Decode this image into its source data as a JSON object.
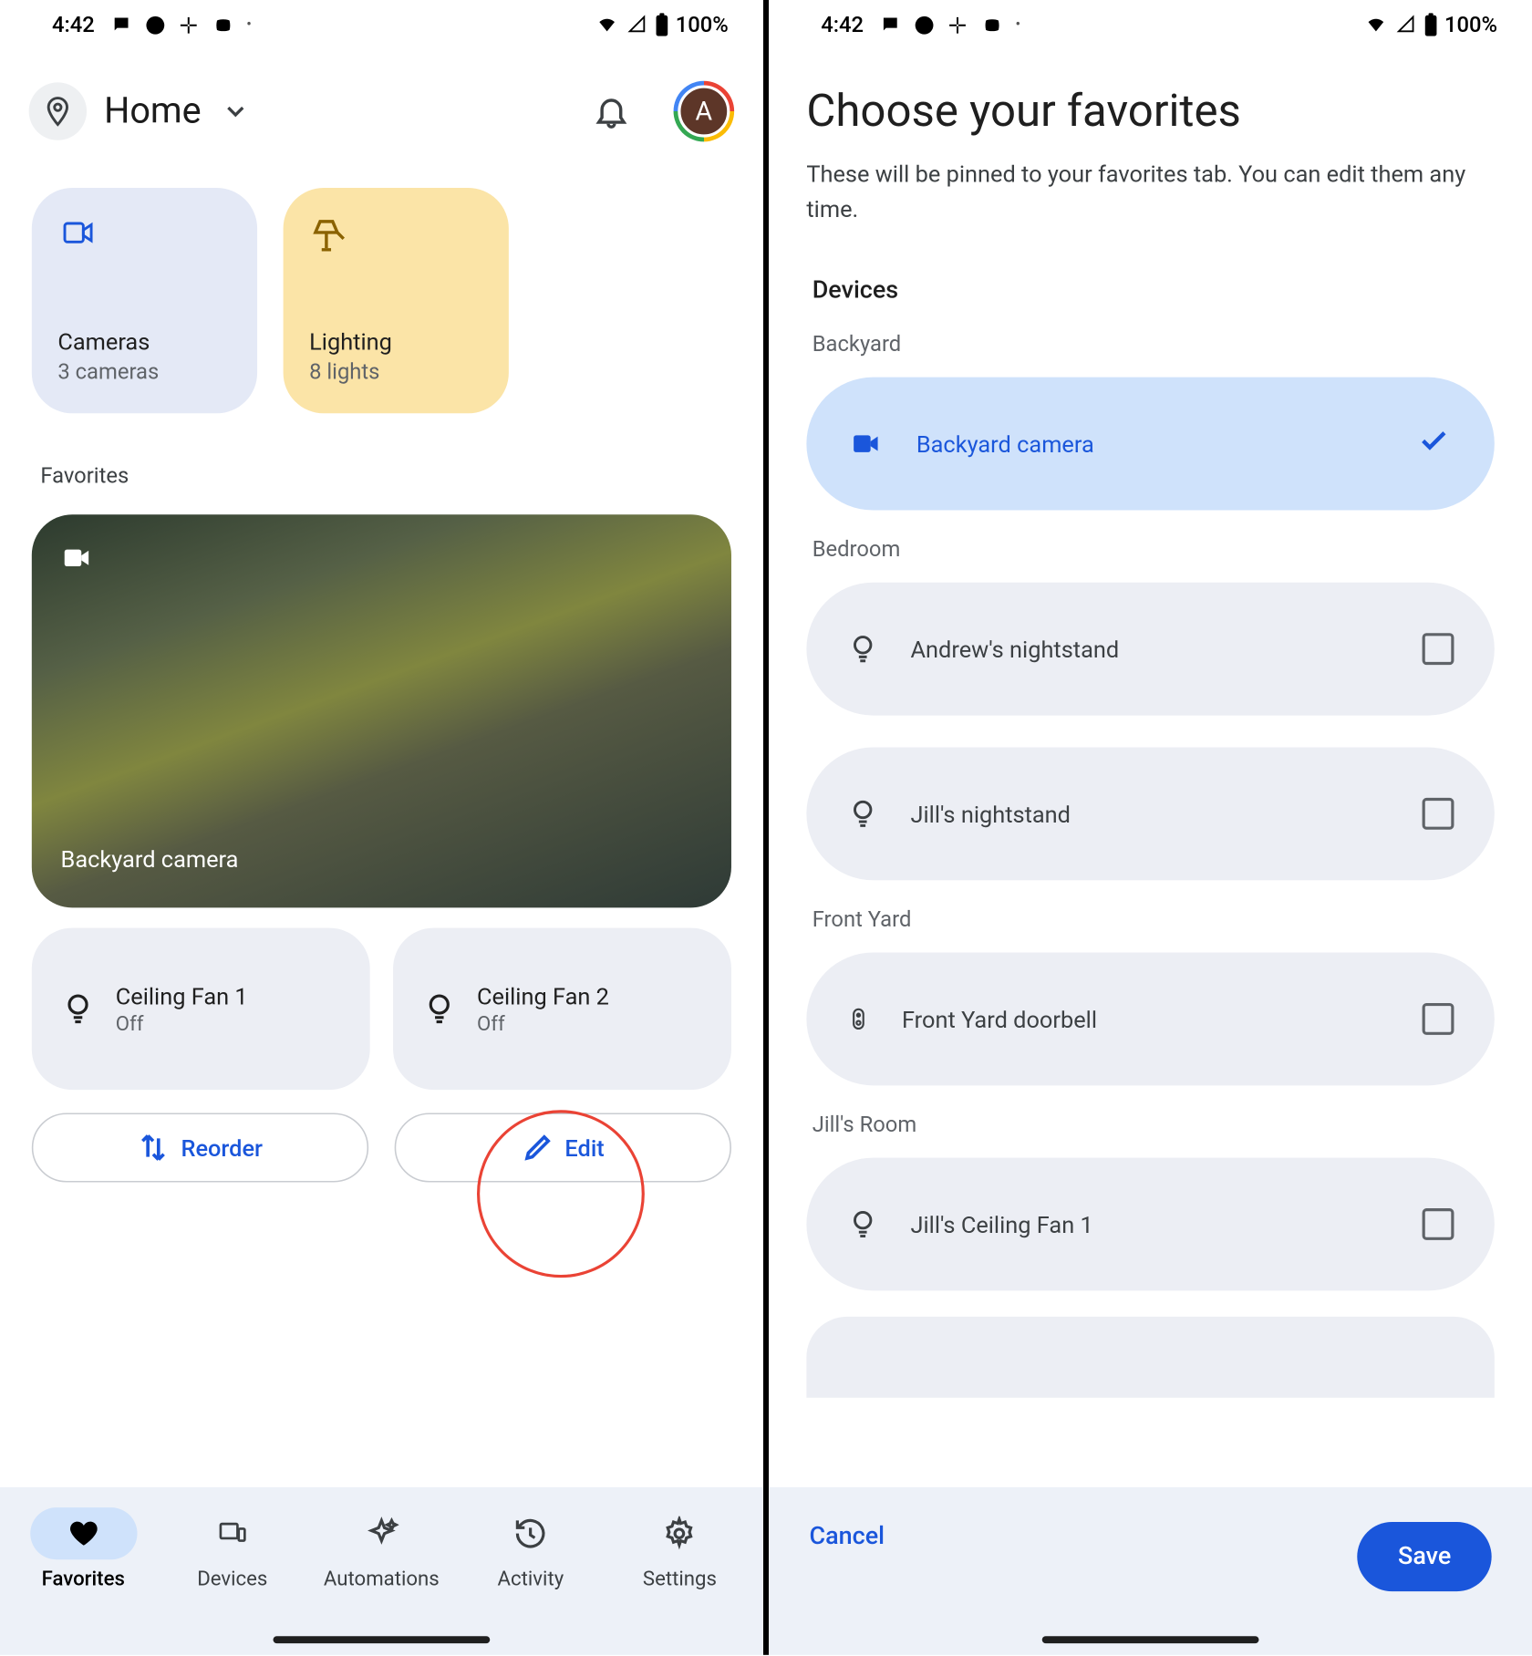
{
  "status": {
    "time": "4:42",
    "battery": "100%"
  },
  "header": {
    "title": "Home",
    "avatar_letter": "A"
  },
  "tiles": {
    "cameras": {
      "title": "Cameras",
      "sub": "3 cameras"
    },
    "lighting": {
      "title": "Lighting",
      "sub": "8 lights"
    }
  },
  "section_favorites": "Favorites",
  "favorites": {
    "camera_name": "Backyard camera",
    "fan1": {
      "name": "Ceiling Fan 1",
      "state": "Off"
    },
    "fan2": {
      "name": "Ceiling Fan 2",
      "state": "Off"
    }
  },
  "actions": {
    "reorder": "Reorder",
    "edit": "Edit"
  },
  "nav": {
    "favorites": "Favorites",
    "devices": "Devices",
    "automations": "Automations",
    "activity": "Activity",
    "settings": "Settings"
  },
  "chooser": {
    "title": "Choose your favorites",
    "subtitle": "These will be pinned to your favorites tab. You can edit them any time.",
    "group": "Devices",
    "rooms": {
      "backyard": {
        "label": "Backyard",
        "item": "Backyard camera"
      },
      "bedroom": {
        "label": "Bedroom",
        "item1": "Andrew's nightstand",
        "item2": "Jill's nightstand"
      },
      "frontyard": {
        "label": "Front Yard",
        "item": "Front Yard doorbell"
      },
      "jillsroom": {
        "label": "Jill's Room",
        "item": "Jill's Ceiling Fan 1"
      }
    },
    "cancel": "Cancel",
    "save": "Save"
  }
}
